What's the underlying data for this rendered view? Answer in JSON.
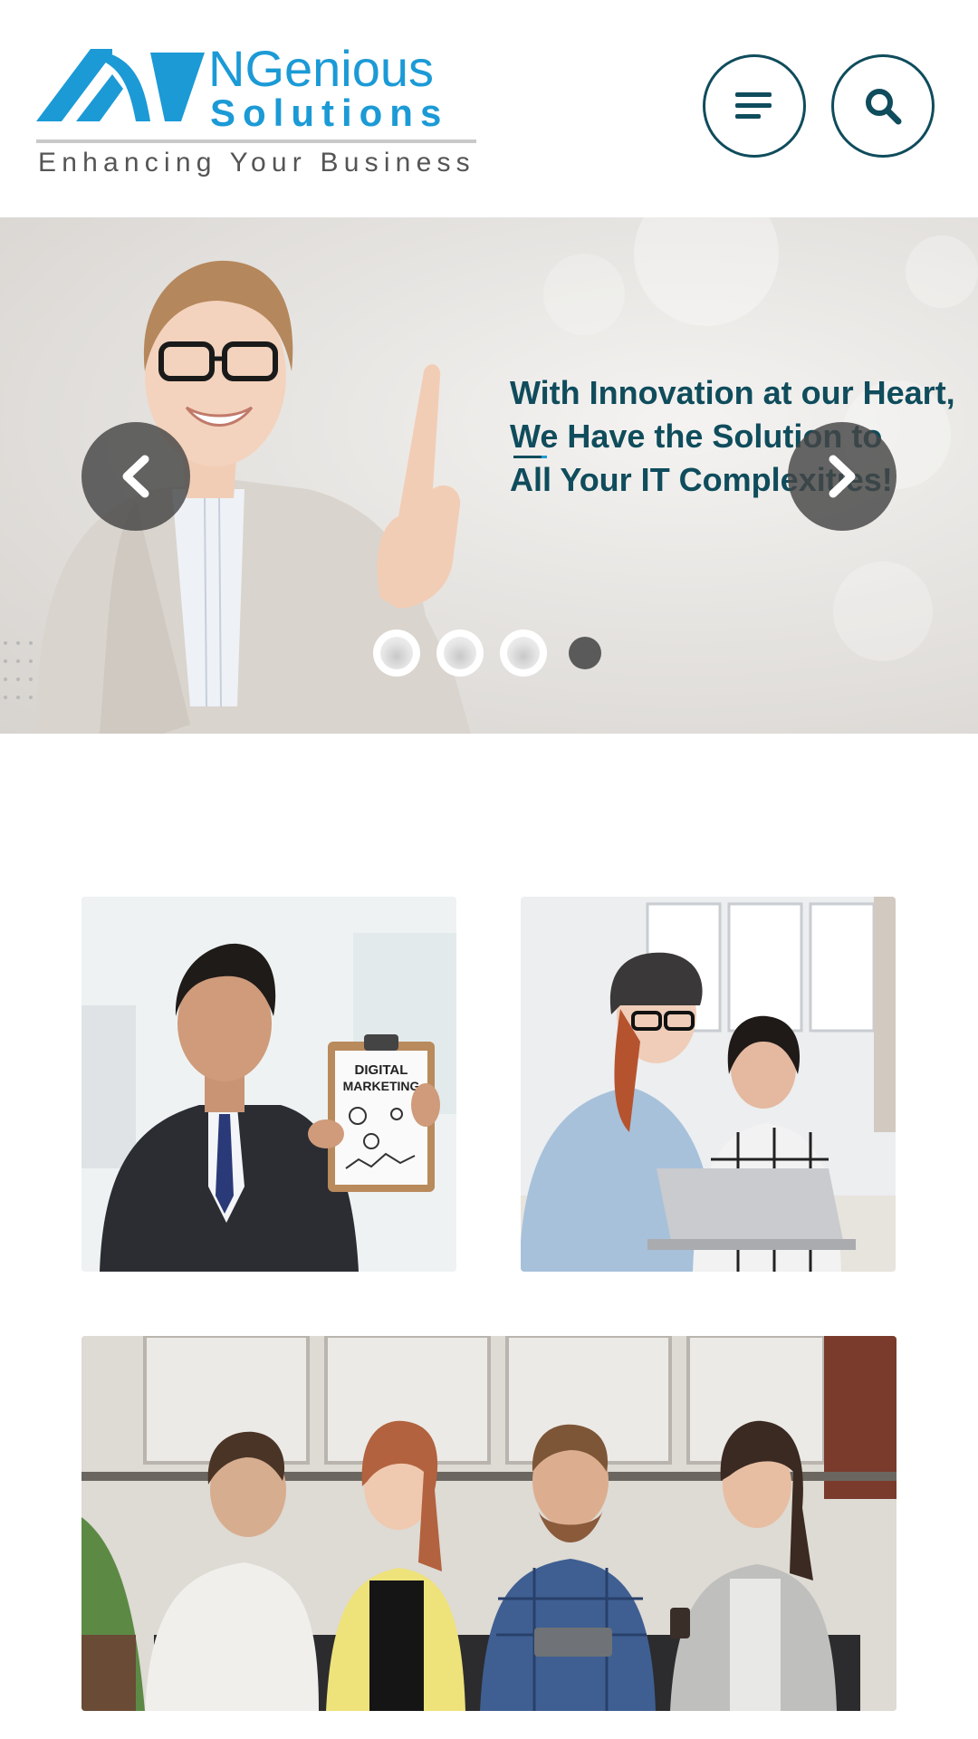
{
  "header": {
    "logo": {
      "name_line_1": "NGenious",
      "name_line_2": "Solutions",
      "tagline": "Enhancing Your Business"
    },
    "menu_icon": "hamburger-menu-icon",
    "search_icon": "search-icon"
  },
  "hero": {
    "caption_lines": [
      "With Innovation at our Heart,",
      "We Have the Solution to",
      "All Your IT Complexities!"
    ],
    "prev_icon": "chevron-left-icon",
    "next_icon": "chevron-right-icon",
    "slide_count": 4,
    "active_slide": 4
  },
  "tiles": [
    {
      "image": "businessman-with-digital-marketing-clipboard",
      "clipboard_title_1": "DIGITAL",
      "clipboard_title_2": "MARKETING"
    },
    {
      "image": "two-women-working-at-laptop"
    },
    {
      "image": "team-of-four-seated-meeting"
    }
  ],
  "colors": {
    "brand_blue": "#1b9ad6",
    "dark_teal": "#0f4c5c",
    "tagline_gray": "#555555"
  }
}
